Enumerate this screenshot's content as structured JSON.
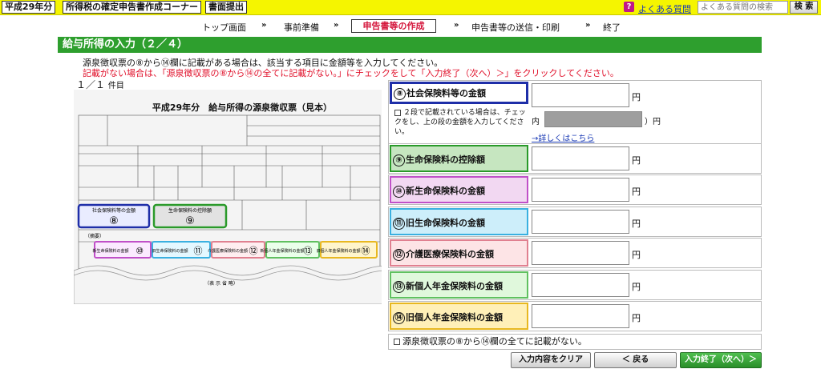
{
  "header": {
    "year_tab": "平成29年分",
    "corner_tab": "所得税の確定申告書作成コーナー",
    "submit_tab": "書面提出",
    "help_icon": "?",
    "faq_link": "よくある質問",
    "search_placeholder": "よくある質問の検索",
    "search_button": "検 索"
  },
  "steps": {
    "items": [
      "トップ画面",
      "事前準備",
      "申告書等の作成",
      "申告書等の送信・印刷",
      "終了"
    ],
    "arrow": "»"
  },
  "page": {
    "title": "給与所得の入力（２／４）",
    "instruction_1": "源泉徴収票の⑧から⑭欄に記載がある場合は、該当する項目に金額等を入力してください。",
    "instruction_2": "記載がない場合は、「源泉徴収票の⑧から⑭の全てに記載がない。」にチェックをして「入力終了（次へ）＞」をクリックしてください。",
    "page_count": "１／１",
    "page_count_unit": "件目"
  },
  "slip": {
    "title": "平成29年分　給与所得の源泉徴収票（見本）",
    "labels": [
      "社会保険料等の金額",
      "生命保険料の控除額",
      "新生命保険料の金額",
      "旧生命保険料の金額",
      "介護医療保険料の金額",
      "新個人年金保険料の金額",
      "旧個人年金保険料の金額"
    ],
    "numbers": [
      "⑧",
      "⑨",
      "⑩",
      "⑪",
      "⑫",
      "⑬",
      "⑭"
    ],
    "bottom_note": "（表 示 省 略）",
    "teki": "（摘要）"
  },
  "rows": [
    {
      "num": "⑧",
      "label": "社会保険料等の金額",
      "value": "",
      "unit": "円",
      "color": "#1e2ea8",
      "bg": "#ffffff"
    },
    {
      "num": "⑨",
      "label": "生命保険料の控除額",
      "value": "",
      "unit": "円",
      "color": "#2a9a2a",
      "bg": "#c6e6c0"
    },
    {
      "num": "⑩",
      "label": "新生命保険料の金額",
      "value": "",
      "unit": "円",
      "color": "#c050c8",
      "bg": "#f2d8f2"
    },
    {
      "num": "⑪",
      "label": "旧生命保険料の金額",
      "value": "",
      "unit": "円",
      "color": "#3ab0e0",
      "bg": "#cdeefa"
    },
    {
      "num": "⑫",
      "label": "介護医療保険料の金額",
      "value": "",
      "unit": "円",
      "color": "#e08090",
      "bg": "#fde4e6"
    },
    {
      "num": "⑬",
      "label": "新個人年金保険料の金額",
      "value": "",
      "unit": "円",
      "color": "#60c060",
      "bg": "#e0f8dc"
    },
    {
      "num": "⑭",
      "label": "旧個人年金保険料の金額",
      "value": "",
      "unit": "円",
      "color": "#e8b820",
      "bg": "#fff0b8"
    }
  ],
  "row8_extra": {
    "checkbox_text": "２段で記載されている場合は、チェックをし、上の段の金額を入力してください。",
    "inner_label": "内（",
    "inner_unit": "）円",
    "detail_link": "→詳しくはこちら"
  },
  "no_entry_checkbox": "源泉徴収票の⑧から⑭欄の全てに記載がない。",
  "buttons": {
    "clear": "入力内容をクリア",
    "back": "＜ 戻る",
    "next": "入力終了（次へ）＞"
  }
}
